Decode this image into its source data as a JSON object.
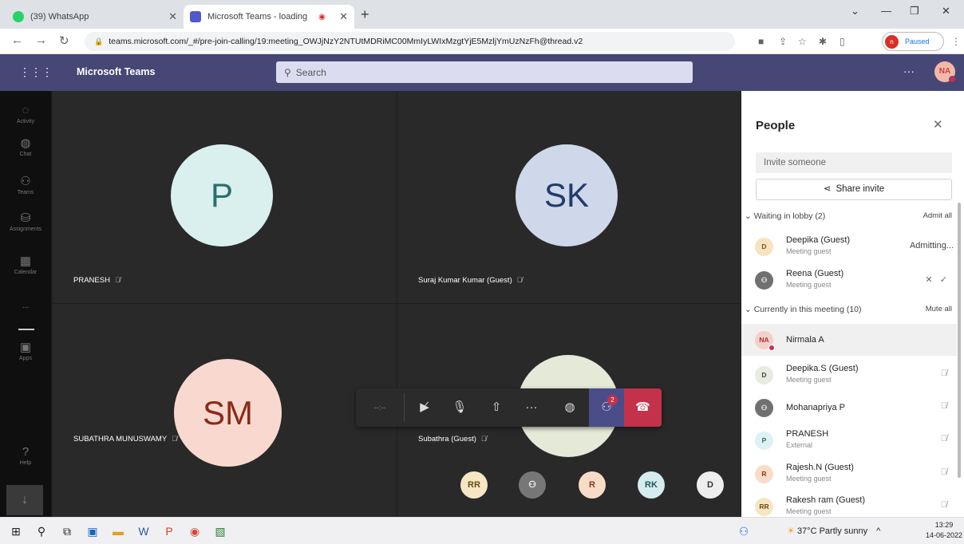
{
  "browser": {
    "tabs": [
      {
        "title": "(39) WhatsApp",
        "icon": "whatsapp-icon",
        "color": "#25d366"
      },
      {
        "title": "Microsoft Teams - loading",
        "icon": "teams-icon",
        "color": "#5059c9"
      }
    ],
    "url": "teams.microsoft.com/_#/pre-join-calling/19:meeting_OWJjNzY2NTUtMDRiMC00MmIyLWIxMzgtYjE5MzljYmUzNzFh@thread.v2",
    "profile_label": "Paused",
    "profile_initial": "n"
  },
  "teams": {
    "brand": "Microsoft Teams",
    "search_placeholder": "Search",
    "user_initials": "NA",
    "accent": "#464775"
  },
  "rail": [
    {
      "label": "Activity",
      "icon": "bell-icon"
    },
    {
      "label": "Chat",
      "icon": "chat-icon"
    },
    {
      "label": "Teams",
      "icon": "teams-icon"
    },
    {
      "label": "Assignments",
      "icon": "assignments-icon"
    },
    {
      "label": "Calendar",
      "icon": "calendar-icon"
    },
    {
      "label": "...",
      "icon": "more-icon"
    },
    {
      "label": "Apps",
      "icon": "apps-icon"
    },
    {
      "label": "Help",
      "icon": "help-icon"
    }
  ],
  "stage": {
    "tiles": [
      {
        "initials": "P",
        "name": "PRANESH",
        "avatar_color": "#d9f0ef",
        "text_color": "#2d6e6a"
      },
      {
        "initials": "SK",
        "name": "Suraj Kumar Kumar (Guest)",
        "avatar_color": "#cfd8ea",
        "text_color": "#243a6a"
      },
      {
        "initials": "SM",
        "name": "SUBATHRA MUNUSWAMY",
        "avatar_color": "#f9d9cf",
        "text_color": "#8a2a1a"
      },
      {
        "initials": "",
        "name": "Subathra (Guest)",
        "avatar_color": "#e5ead8",
        "text_color": "#333"
      }
    ],
    "overflow": [
      {
        "initials": "RR",
        "color": "#f6e6c4",
        "text": "#6a4a10"
      },
      {
        "initials": "",
        "color": "#777",
        "text": "#fff"
      },
      {
        "initials": "R",
        "color": "#f9dcc8",
        "text": "#8a3a10"
      },
      {
        "initials": "RK",
        "color": "#d5ecef",
        "text": "#225560"
      },
      {
        "initials": "D",
        "color": "#eee",
        "text": "#333"
      }
    ]
  },
  "controls": {
    "timer": "--:--",
    "people_badge": "2"
  },
  "people": {
    "title": "People",
    "invite_placeholder": "Invite someone",
    "share_invite": "Share invite",
    "lobby_label": "Waiting in lobby (2)",
    "admit_all": "Admit all",
    "lobby": [
      {
        "initials": "D",
        "name": "Deepika (Guest)",
        "sub": "Meeting guest",
        "action": "Admitting...",
        "color": "#f7e3c0",
        "text": "#7a5510"
      },
      {
        "initials": "",
        "name": "Reena (Guest)",
        "sub": "Meeting guest",
        "action": "",
        "color": "#707070",
        "text": "#fff"
      }
    ],
    "meeting_label": "Currently in this meeting (10)",
    "mute_all": "Mute all",
    "members": [
      {
        "initials": "NA",
        "name": "Nirmala A",
        "sub": "",
        "color": "#f5d0c8",
        "text": "#b03030",
        "status": true,
        "highlight": true
      },
      {
        "initials": "D",
        "name": "Deepika.S (Guest)",
        "sub": "Meeting guest",
        "color": "#e8ece0",
        "text": "#444"
      },
      {
        "initials": "",
        "name": "Mohanapriya P",
        "sub": "",
        "color": "#707070",
        "text": "#fff"
      },
      {
        "initials": "P",
        "name": "PRANESH",
        "sub": "External",
        "color": "#dff1f2",
        "text": "#2d6e6a"
      },
      {
        "initials": "R",
        "name": "Rajesh.N (Guest)",
        "sub": "Meeting guest",
        "color": "#f9dcc8",
        "text": "#8a3a10"
      },
      {
        "initials": "RR",
        "name": "Rakesh ram (Guest)",
        "sub": "Meeting guest",
        "color": "#f6e6c4",
        "text": "#6a4a10"
      }
    ]
  },
  "taskbar": {
    "weather": "37°C Partly sunny",
    "time": "13:29",
    "date": "14-06-2022"
  }
}
